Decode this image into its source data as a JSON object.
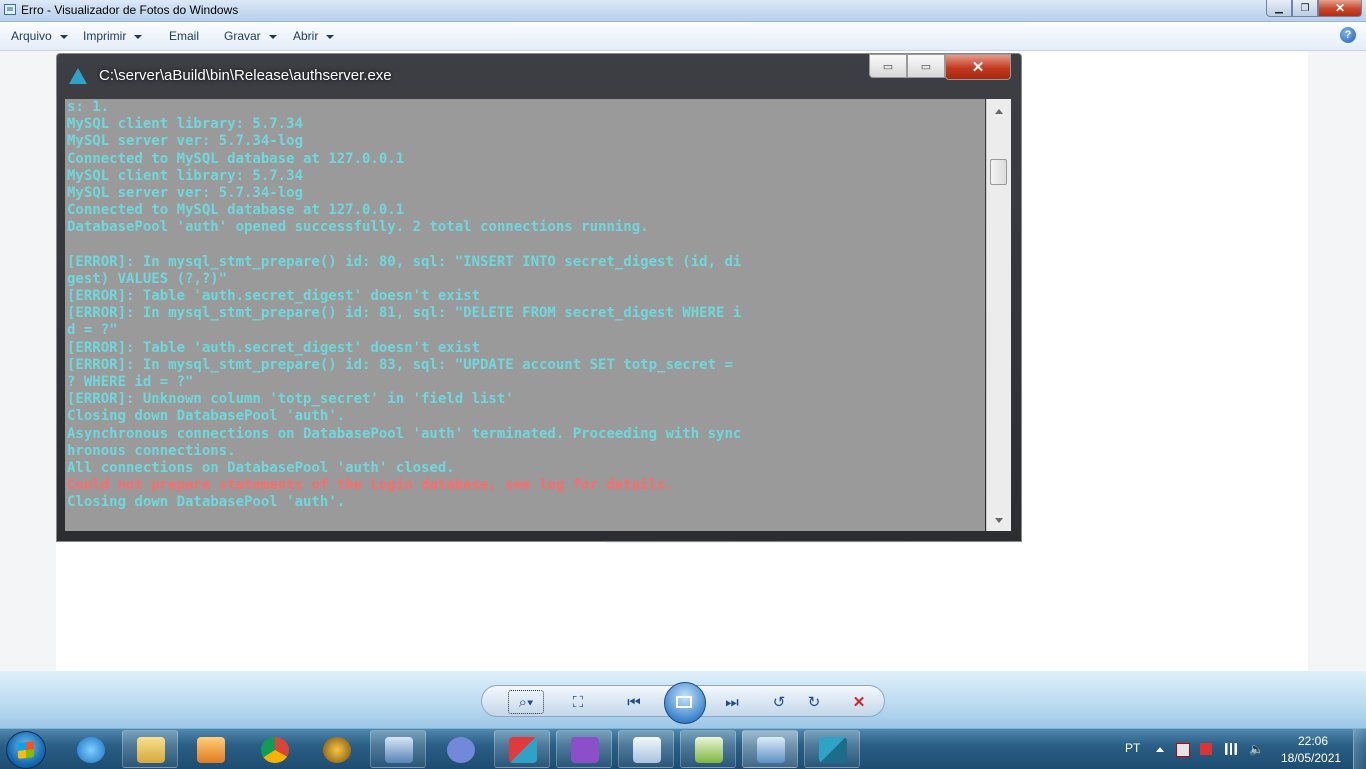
{
  "window": {
    "title": "Erro - Visualizador de Fotos do Windows",
    "controls": {
      "minimize": "▁",
      "maximize": "❐",
      "close": "✕"
    }
  },
  "menu": {
    "items": [
      {
        "label": "Arquivo",
        "dropdown": true
      },
      {
        "label": "Imprimir",
        "dropdown": true
      },
      {
        "label": "Email",
        "dropdown": false
      },
      {
        "label": "Gravar",
        "dropdown": true
      },
      {
        "label": "Abrir",
        "dropdown": true
      }
    ],
    "help": "?"
  },
  "photo": {
    "console": {
      "title": "C:\\server\\aBuild\\bin\\Release\\authserver.exe",
      "controls": {
        "minimize": "▭",
        "maximize": "▭",
        "close": "✕"
      },
      "lines": [
        {
          "text": "s: 1.",
          "error": false
        },
        {
          "text": "MySQL client library: 5.7.34",
          "error": false
        },
        {
          "text": "MySQL server ver: 5.7.34-log",
          "error": false
        },
        {
          "text": "Connected to MySQL database at 127.0.0.1",
          "error": false
        },
        {
          "text": "MySQL client library: 5.7.34",
          "error": false
        },
        {
          "text": "MySQL server ver: 5.7.34-log",
          "error": false
        },
        {
          "text": "Connected to MySQL database at 127.0.0.1",
          "error": false
        },
        {
          "text": "DatabasePool 'auth' opened successfully. 2 total connections running.",
          "error": false
        },
        {
          "text": "",
          "error": false
        },
        {
          "text": "[ERROR]: In mysql_stmt_prepare() id: 80, sql: \"INSERT INTO secret_digest (id, di",
          "error": false
        },
        {
          "text": "gest) VALUES (?,?)\"",
          "error": false
        },
        {
          "text": "[ERROR]: Table 'auth.secret_digest' doesn't exist",
          "error": false
        },
        {
          "text": "[ERROR]: In mysql_stmt_prepare() id: 81, sql: \"DELETE FROM secret_digest WHERE i",
          "error": false
        },
        {
          "text": "d = ?\"",
          "error": false
        },
        {
          "text": "[ERROR]: Table 'auth.secret_digest' doesn't exist",
          "error": false
        },
        {
          "text": "[ERROR]: In mysql_stmt_prepare() id: 83, sql: \"UPDATE account SET totp_secret =",
          "error": false
        },
        {
          "text": "? WHERE id = ?\"",
          "error": false
        },
        {
          "text": "[ERROR]: Unknown column 'totp_secret' in 'field list'",
          "error": false
        },
        {
          "text": "Closing down DatabasePool 'auth'.",
          "error": false
        },
        {
          "text": "Asynchronous connections on DatabasePool 'auth' terminated. Proceeding with sync",
          "error": false
        },
        {
          "text": "hronous connections.",
          "error": false
        },
        {
          "text": "All connections on DatabasePool 'auth' closed.",
          "error": false
        },
        {
          "text": "Could not prepare statements of the Login database, see log for details.",
          "error": true
        },
        {
          "text": "Closing down DatabasePool 'auth'.",
          "error": false
        }
      ]
    }
  },
  "viewer_controls": [
    "zoom-icon",
    "fit-window-icon",
    "previous-icon",
    "slideshow-icon",
    "next-icon",
    "rotate-left-icon",
    "rotate-right-icon",
    "delete-icon"
  ],
  "taskbar": {
    "apps": [
      "internet-explorer-icon",
      "file-explorer-icon",
      "media-player-icon",
      "chrome-icon",
      "world-of-warcraft-icon",
      "network-app-icon",
      "discord-icon",
      "authserver-icon",
      "visual-studio-icon",
      "notepad-icon",
      "notepadpp-icon",
      "photo-viewer-icon",
      "worldserver-icon"
    ],
    "language": "PT",
    "time": "22:06",
    "date": "18/05/2021"
  }
}
